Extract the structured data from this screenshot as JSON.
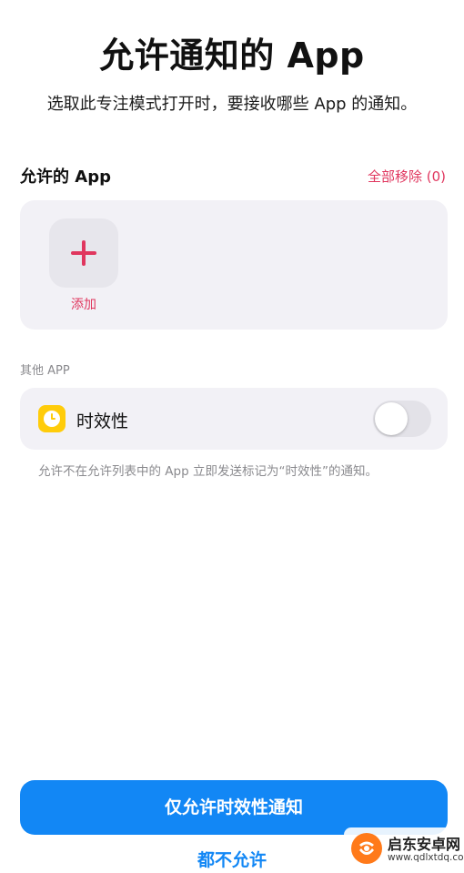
{
  "header": {
    "title": "允许通知的 App",
    "subtitle": "选取此专注模式打开时，要接收哪些 App 的通知。"
  },
  "allowed_apps": {
    "section_title": "允许的 App",
    "remove_all_label": "全部移除 (0)",
    "add_label": "添加"
  },
  "other_apps": {
    "section_label": "其他 APP",
    "time_sensitive": {
      "label": "时效性",
      "icon": "clock-icon",
      "toggle_on": false
    },
    "footnote": "允许不在允许列表中的 App 立即发送标记为“时效性”的通知。"
  },
  "actions": {
    "primary_label": "仅允许时效性通知",
    "secondary_label": "都不允许"
  },
  "watermark": {
    "name": "启东安卓网",
    "url": "www.qdlxtdq.com"
  },
  "colors": {
    "accent_pink": "#e0365e",
    "accent_blue": "#1287f5",
    "card_background": "#f2f1f6",
    "time_icon": "#ffcc0a"
  }
}
